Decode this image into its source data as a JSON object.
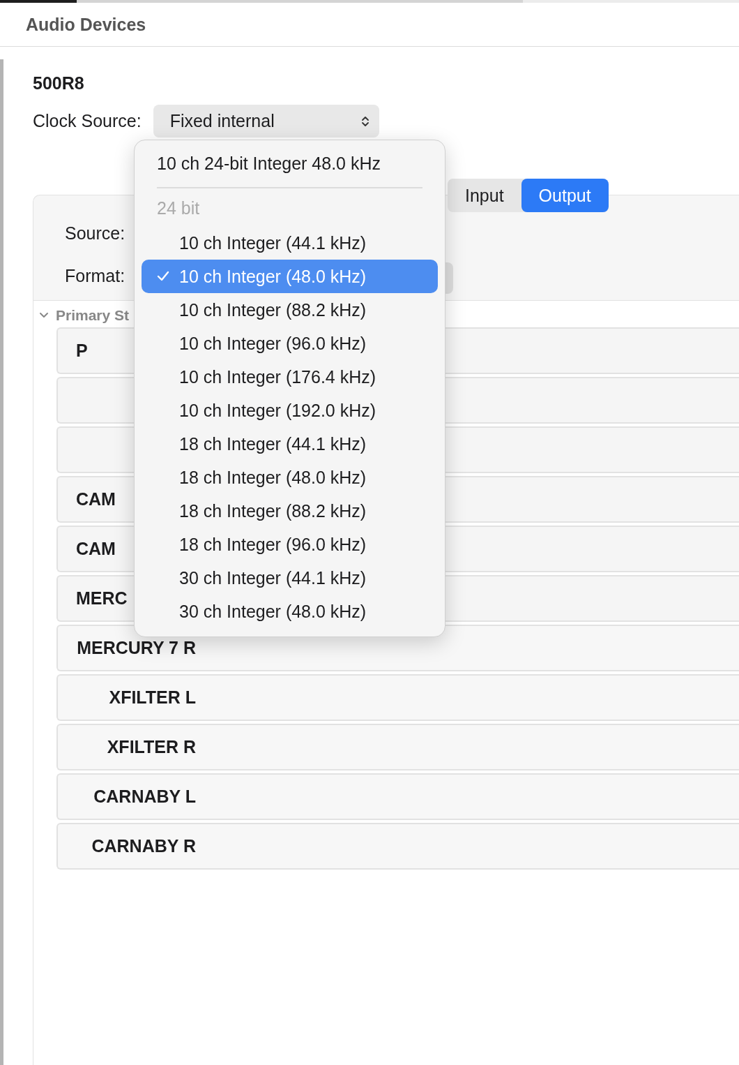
{
  "window": {
    "title": "Audio Devices"
  },
  "device": {
    "name": "500R8",
    "clock_label": "Clock Source:",
    "clock_value": "Fixed internal"
  },
  "tabs": [
    {
      "label": "Input",
      "selected": false
    },
    {
      "label": "Output",
      "selected": true
    }
  ],
  "fields": [
    {
      "label": "Source:"
    },
    {
      "label": "Format:"
    }
  ],
  "section": {
    "title": "Primary St",
    "expanded": true
  },
  "channels": [
    {
      "label": "P",
      "kind": "covered"
    },
    {
      "kind": "covered"
    },
    {
      "kind": "covered"
    },
    {
      "label": "CAM",
      "kind": "covered"
    },
    {
      "label": "CAM",
      "kind": "covered"
    },
    {
      "label": "MERC",
      "kind": "covered"
    },
    {
      "label": "MERCURY 7 R",
      "kind": "full"
    },
    {
      "label": "XFILTER L",
      "kind": "full"
    },
    {
      "label": "XFILTER R",
      "kind": "full"
    },
    {
      "label": "CARNABY L",
      "kind": "full"
    },
    {
      "label": "CARNABY R",
      "kind": "full"
    }
  ],
  "format_menu": {
    "current": "10 ch 24-bit Integer 48.0 kHz",
    "group": "24 bit",
    "items": [
      {
        "label": "10 ch Integer (44.1 kHz)",
        "selected": false
      },
      {
        "label": "10 ch Integer (48.0 kHz)",
        "selected": true
      },
      {
        "label": "10 ch Integer (88.2 kHz)",
        "selected": false
      },
      {
        "label": "10 ch Integer (96.0 kHz)",
        "selected": false
      },
      {
        "label": "10 ch Integer (176.4 kHz)",
        "selected": false
      },
      {
        "label": "10 ch Integer (192.0 kHz)",
        "selected": false
      },
      {
        "label": "18 ch Integer (44.1 kHz)",
        "selected": false
      },
      {
        "label": "18 ch Integer (48.0 kHz)",
        "selected": false
      },
      {
        "label": "18 ch Integer (88.2 kHz)",
        "selected": false
      },
      {
        "label": "18 ch Integer (96.0 kHz)",
        "selected": false
      },
      {
        "label": "30 ch Integer (44.1 kHz)",
        "selected": false
      },
      {
        "label": "30 ch Integer (48.0 kHz)",
        "selected": false
      }
    ]
  }
}
